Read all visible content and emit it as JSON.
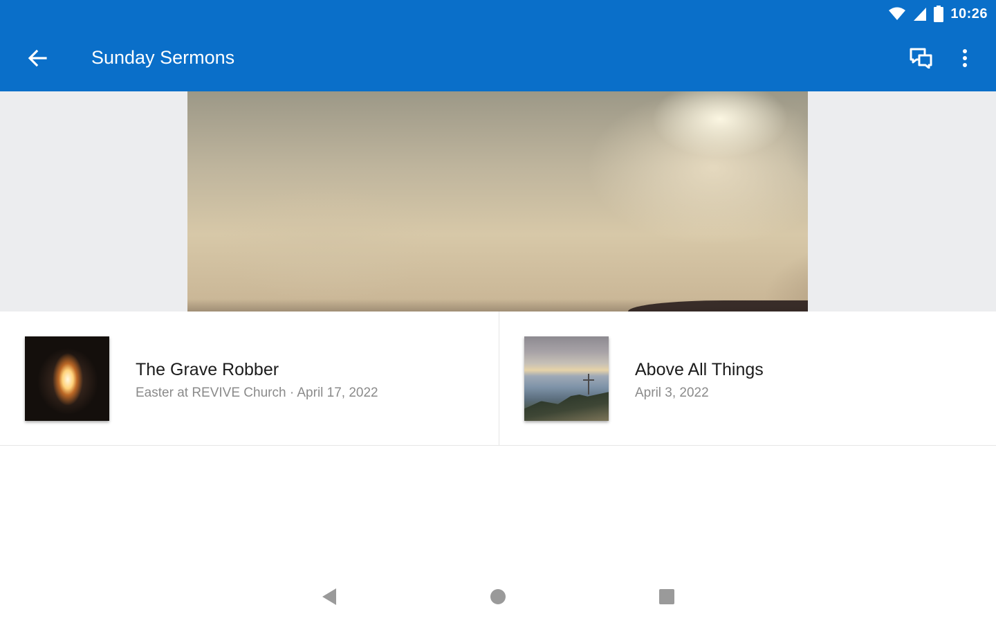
{
  "status_bar": {
    "time": "10:26",
    "icons": [
      "wifi-icon",
      "cell-signal-icon",
      "battery-icon"
    ]
  },
  "app_bar": {
    "title": "Sunday Sermons",
    "back_icon": "arrow-left-icon",
    "actions": [
      "chat-icon",
      "more-vert-icon"
    ]
  },
  "sermons": [
    {
      "title": "The Grave Robber",
      "subtitle": "Easter at REVIVE Church · April 17, 2022",
      "thumbnail": "empty-tomb-light"
    },
    {
      "title": "Above All Things",
      "subtitle": "April 3, 2022",
      "thumbnail": "cross-on-mountain"
    }
  ],
  "nav_bar": {
    "buttons": [
      "nav-back-icon",
      "nav-home-icon",
      "nav-recents-icon"
    ]
  },
  "colors": {
    "primary": "#0a6fc9",
    "hero_background": "#ecedef",
    "title_text": "#1c1c1c",
    "subtitle_text": "#8a8a8a"
  }
}
